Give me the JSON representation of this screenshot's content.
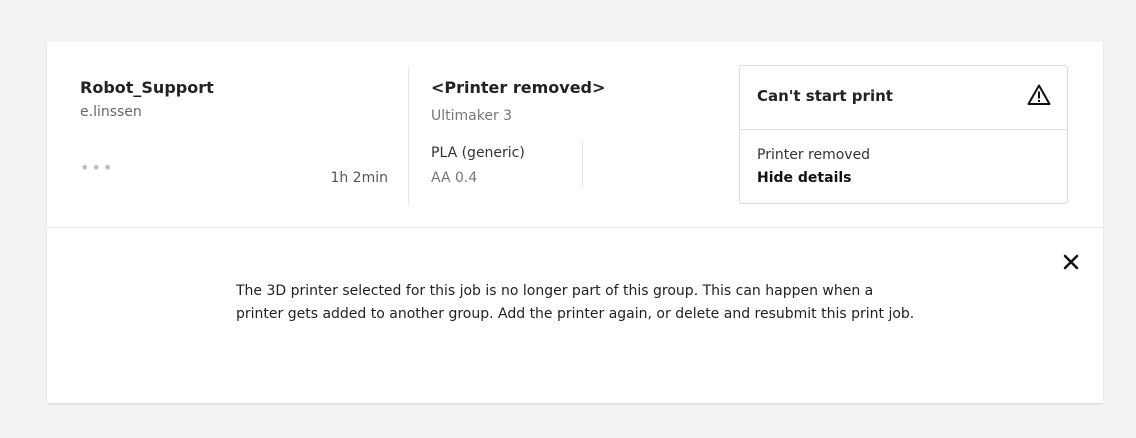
{
  "job": {
    "name": "Robot_Support",
    "owner": "e.linssen",
    "more_label": "•••",
    "duration": "1h 2min"
  },
  "printer": {
    "name": "<Printer removed>",
    "type": "Ultimaker 3",
    "material": "PLA (generic)",
    "nozzle": "AA 0.4"
  },
  "status": {
    "title": "Can't start print",
    "icon": "warning-triangle-icon",
    "message": "Printer removed",
    "hide_details_label": "Hide details"
  },
  "details": {
    "text": "The 3D printer selected for this job is no longer part of this group. This can happen when a printer gets added to another group. Add the printer again, or delete and resubmit this print job.",
    "close_icon": "close-icon"
  }
}
